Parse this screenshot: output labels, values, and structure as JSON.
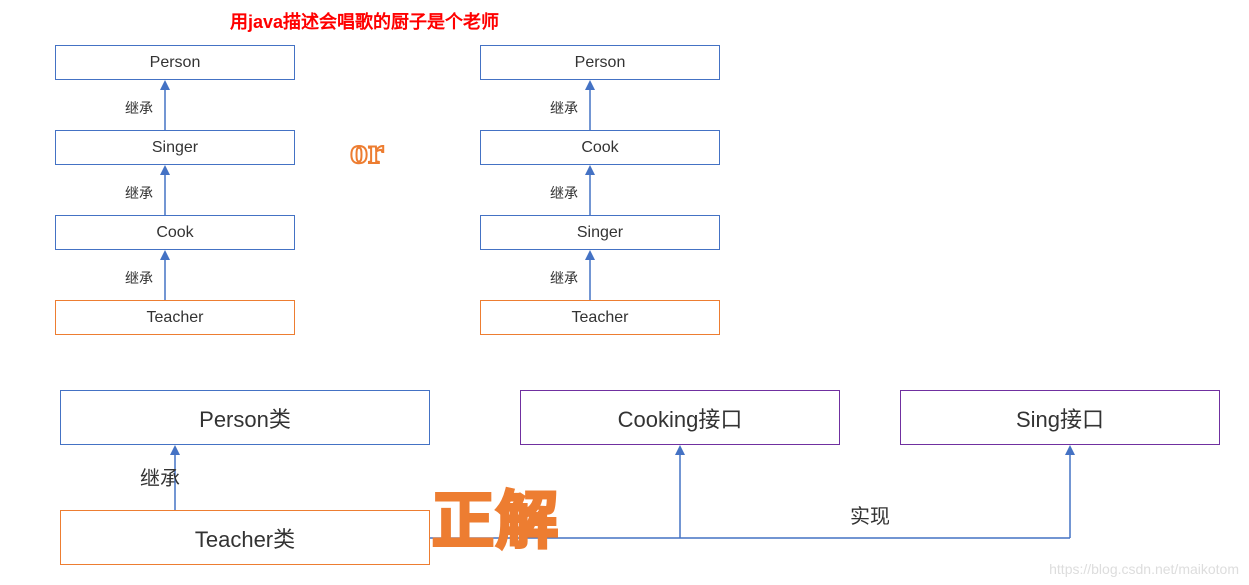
{
  "title": "用java描述会唱歌的厨子是个老师",
  "orText": "or",
  "answerText": "正解",
  "labels": {
    "inherit": "继承",
    "implement": "实现"
  },
  "hierarchy1": {
    "box1": "Person",
    "box2": "Singer",
    "box3": "Cook",
    "box4": "Teacher"
  },
  "hierarchy2": {
    "box1": "Person",
    "box2": "Cook",
    "box3": "Singer",
    "box4": "Teacher"
  },
  "solution": {
    "personClass": "Person类",
    "teacherClass": "Teacher类",
    "cookingInterface": "Cooking接口",
    "singInterface": "Sing接口"
  },
  "watermark": "https://blog.csdn.net/maikotom",
  "colors": {
    "blue": "#4472C4",
    "orange": "#ED7D31",
    "purple": "#7030A0",
    "red": "#ff0000"
  }
}
